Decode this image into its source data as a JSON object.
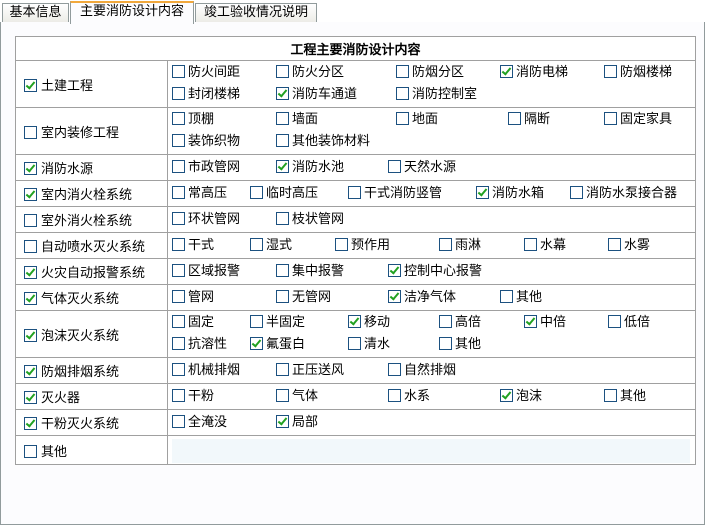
{
  "tabs": [
    {
      "label": "基本信息",
      "active": false
    },
    {
      "label": "主要消防设计内容",
      "active": true
    },
    {
      "label": "竣工验收情况说明",
      "active": false
    }
  ],
  "table": {
    "title": "工程主要消防设计内容",
    "rows": [
      {
        "label": "土建工程",
        "checked": true,
        "options": [
          [
            {
              "label": "防火间距",
              "checked": false
            },
            {
              "label": "防火分区",
              "checked": false
            },
            {
              "label": "防烟分区",
              "checked": false
            },
            {
              "label": "消防电梯",
              "checked": true
            },
            {
              "label": "防烟楼梯",
              "checked": false
            }
          ],
          [
            {
              "label": "封闭楼梯",
              "checked": false
            },
            {
              "label": "消防车通道",
              "checked": true
            },
            {
              "label": "消防控制室",
              "checked": false
            }
          ]
        ]
      },
      {
        "label": "室内装修工程",
        "checked": false,
        "options": [
          [
            {
              "label": "顶棚",
              "checked": false
            },
            {
              "label": "墙面",
              "checked": false
            },
            {
              "label": "地面",
              "checked": false
            },
            {
              "label": "隔断",
              "checked": false
            },
            {
              "label": "固定家具",
              "checked": false
            }
          ],
          [
            {
              "label": "装饰织物",
              "checked": false
            },
            {
              "label": "其他装饰材料",
              "checked": false
            }
          ]
        ]
      },
      {
        "label": "消防水源",
        "checked": true,
        "options": [
          [
            {
              "label": "市政管网",
              "checked": false
            },
            {
              "label": "消防水池",
              "checked": true
            },
            {
              "label": "天然水源",
              "checked": false
            }
          ]
        ]
      },
      {
        "label": "室内消火栓系统",
        "checked": true,
        "options": [
          [
            {
              "label": "常高压",
              "checked": false
            },
            {
              "label": "临时高压",
              "checked": false
            },
            {
              "label": "干式消防竖管",
              "checked": false
            },
            {
              "label": "消防水箱",
              "checked": true
            },
            {
              "label": "消防水泵接合器",
              "checked": false
            }
          ]
        ]
      },
      {
        "label": "室外消火栓系统",
        "checked": false,
        "options": [
          [
            {
              "label": "环状管网",
              "checked": false
            },
            {
              "label": "枝状管网",
              "checked": false
            }
          ]
        ]
      },
      {
        "label": "自动喷水灭火系统",
        "checked": false,
        "options": [
          [
            {
              "label": "干式",
              "checked": false
            },
            {
              "label": "湿式",
              "checked": false
            },
            {
              "label": "预作用",
              "checked": false
            },
            {
              "label": "雨淋",
              "checked": false
            },
            {
              "label": "水幕",
              "checked": false
            },
            {
              "label": "水雾",
              "checked": false
            }
          ]
        ]
      },
      {
        "label": "火灾自动报警系统",
        "checked": true,
        "options": [
          [
            {
              "label": "区域报警",
              "checked": false
            },
            {
              "label": "集中报警",
              "checked": false
            },
            {
              "label": "控制中心报警",
              "checked": true
            }
          ]
        ]
      },
      {
        "label": "气体灭火系统",
        "checked": true,
        "options": [
          [
            {
              "label": "管网",
              "checked": false
            },
            {
              "label": "无管网",
              "checked": false
            },
            {
              "label": "洁净气体",
              "checked": true
            },
            {
              "label": "其他",
              "checked": false
            }
          ]
        ]
      },
      {
        "label": "泡沫灭火系统",
        "checked": true,
        "options": [
          [
            {
              "label": "固定",
              "checked": false
            },
            {
              "label": "半固定",
              "checked": false
            },
            {
              "label": "移动",
              "checked": true
            },
            {
              "label": "高倍",
              "checked": false
            },
            {
              "label": "中倍",
              "checked": true
            },
            {
              "label": "低倍",
              "checked": false
            }
          ],
          [
            {
              "label": "抗溶性",
              "checked": false
            },
            {
              "label": "氟蛋白",
              "checked": true
            },
            {
              "label": "清水",
              "checked": false
            },
            {
              "label": "其他",
              "checked": false
            }
          ]
        ]
      },
      {
        "label": "防烟排烟系统",
        "checked": true,
        "options": [
          [
            {
              "label": "机械排烟",
              "checked": false
            },
            {
              "label": "正压送风",
              "checked": false
            },
            {
              "label": "自然排烟",
              "checked": false
            }
          ]
        ]
      },
      {
        "label": "灭火器",
        "checked": true,
        "options": [
          [
            {
              "label": "干粉",
              "checked": false
            },
            {
              "label": "气体",
              "checked": false
            },
            {
              "label": "水系",
              "checked": false
            },
            {
              "label": "泡沫",
              "checked": true
            },
            {
              "label": "其他",
              "checked": false
            }
          ]
        ]
      },
      {
        "label": "干粉灭火系统",
        "checked": true,
        "options": [
          [
            {
              "label": "全淹没",
              "checked": false
            },
            {
              "label": "局部",
              "checked": true
            }
          ]
        ]
      },
      {
        "label": "其他",
        "checked": false,
        "input": {
          "value": "",
          "placeholder": ""
        }
      }
    ]
  }
}
